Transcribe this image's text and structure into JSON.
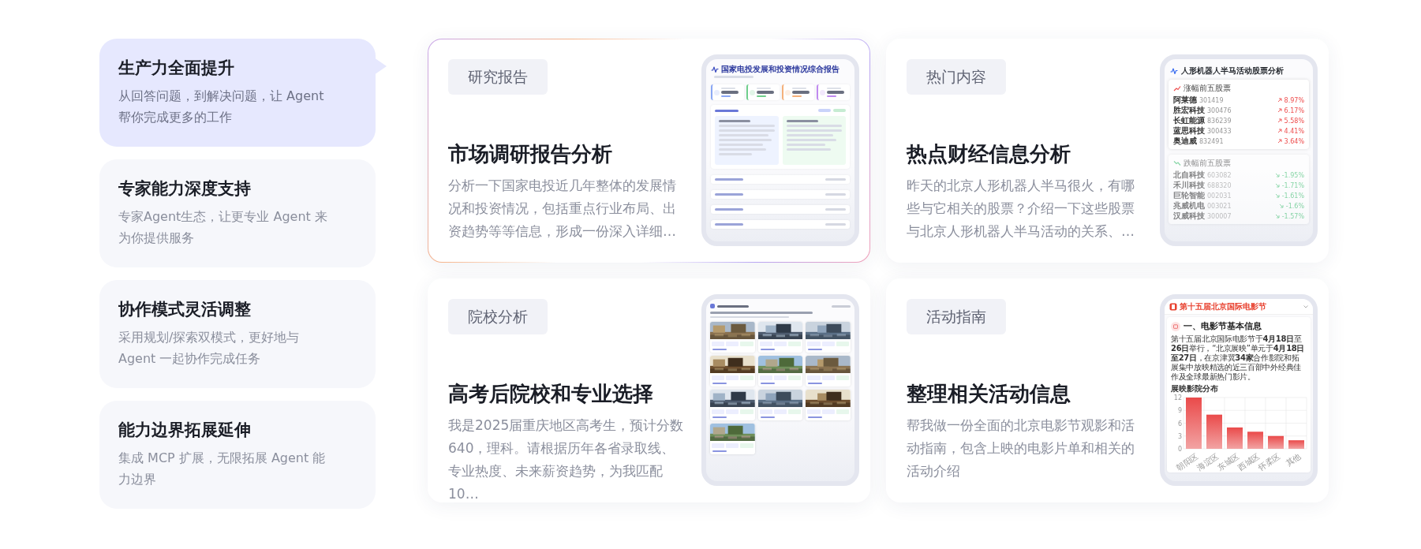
{
  "features": [
    {
      "title": "生产力全面提升",
      "description": "从回答问题，到解决问题，让 Agent 帮你完成更多的工作",
      "selected": true
    },
    {
      "title": "专家能力深度支持",
      "description": "专家Agent生态，让更专业 Agent 来为你提供服务",
      "selected": false
    },
    {
      "title": "协作模式灵活调整",
      "description": "采用规划/探索双模式，更好地与 Agent 一起协作完成任务",
      "selected": false
    },
    {
      "title": "能力边界拓展延伸",
      "description": "集成 MCP 扩展，无限拓展 Agent 能力边界",
      "selected": false
    }
  ],
  "cards": [
    {
      "tag": "研究报告",
      "title": "市场调研报告分析",
      "description": "分析一下国家电投近几年整体的发展情况和投资情况，包括重点行业布局、出资趋势等等信息，形成一份深入详细…",
      "highlighted": true,
      "preview": {
        "kind": "report",
        "title": "国家电投发展和投资情况综合报告"
      }
    },
    {
      "tag": "热门内容",
      "title": "热点财经信息分析",
      "description": "昨天的北京人形机器人半马很火，有哪些与它相关的股票？介绍一下这些股票与北京人形机器人半马活动的关系、…",
      "highlighted": false,
      "preview": {
        "kind": "stocks",
        "title": "人形机器人半马活动股票分析",
        "groups": [
          {
            "heading": "涨幅前五股票",
            "kind": "up",
            "rows": [
              {
                "name": "阿莱德",
                "code": "301419",
                "change": "8.97%"
              },
              {
                "name": "胜宏科技",
                "code": "300476",
                "change": "6.17%"
              },
              {
                "name": "长虹能源",
                "code": "836239",
                "change": "5.58%"
              },
              {
                "name": "蓝思科技",
                "code": "300433",
                "change": "4.41%"
              },
              {
                "name": "奥迪威",
                "code": "832491",
                "change": "3.64%"
              }
            ]
          },
          {
            "heading": "跌幅前五股票",
            "kind": "down",
            "rows": [
              {
                "name": "北自科技",
                "code": "603082",
                "change": "-1.95%"
              },
              {
                "name": "禾川科技",
                "code": "688320",
                "change": "-1.71%"
              },
              {
                "name": "巨轮智能",
                "code": "002031",
                "change": "-1.61%"
              },
              {
                "name": "兆威机电",
                "code": "003021",
                "change": "-1.6%"
              },
              {
                "name": "汉威科技",
                "code": "300007",
                "change": "-1.57%"
              }
            ]
          }
        ]
      }
    },
    {
      "tag": "院校分析",
      "title": "高考后院校和专业选择",
      "description": "我是2025届重庆地区高考生，预计分数640，理科。请根据历年各省录取线、专业热度、未来薪资趋势，为我匹配10…",
      "highlighted": false,
      "preview": {
        "kind": "schools"
      }
    },
    {
      "tag": "活动指南",
      "title": "整理相关活动信息",
      "description": "帮我做一份全面的北京电影节观影和活动指南，包含上映的电影片单和相关的活动介绍",
      "highlighted": false,
      "preview": {
        "kind": "event",
        "title": "第十五届北京国际电影节",
        "heading": "一、电影节基本信息",
        "text": "第十五届北京国际电影节于**4月18日**至**26日**举行，“北京展映”单元于**4月18日至27日**，在京津冀**34家**合作影院和拓展集中放映精选的近三百部中外经典佳作及全球最新热门影片。",
        "chart_data": {
          "type": "bar",
          "title": "展映影院分布",
          "categories": [
            "朝阳区",
            "海淀区",
            "东城区",
            "西城区",
            "怀柔区",
            "其他"
          ],
          "values": [
            12,
            8,
            5,
            4,
            3,
            2
          ],
          "ylim": [
            0,
            12
          ],
          "grid": true,
          "yticks": [
            0,
            3,
            6,
            9,
            12
          ]
        }
      }
    }
  ]
}
